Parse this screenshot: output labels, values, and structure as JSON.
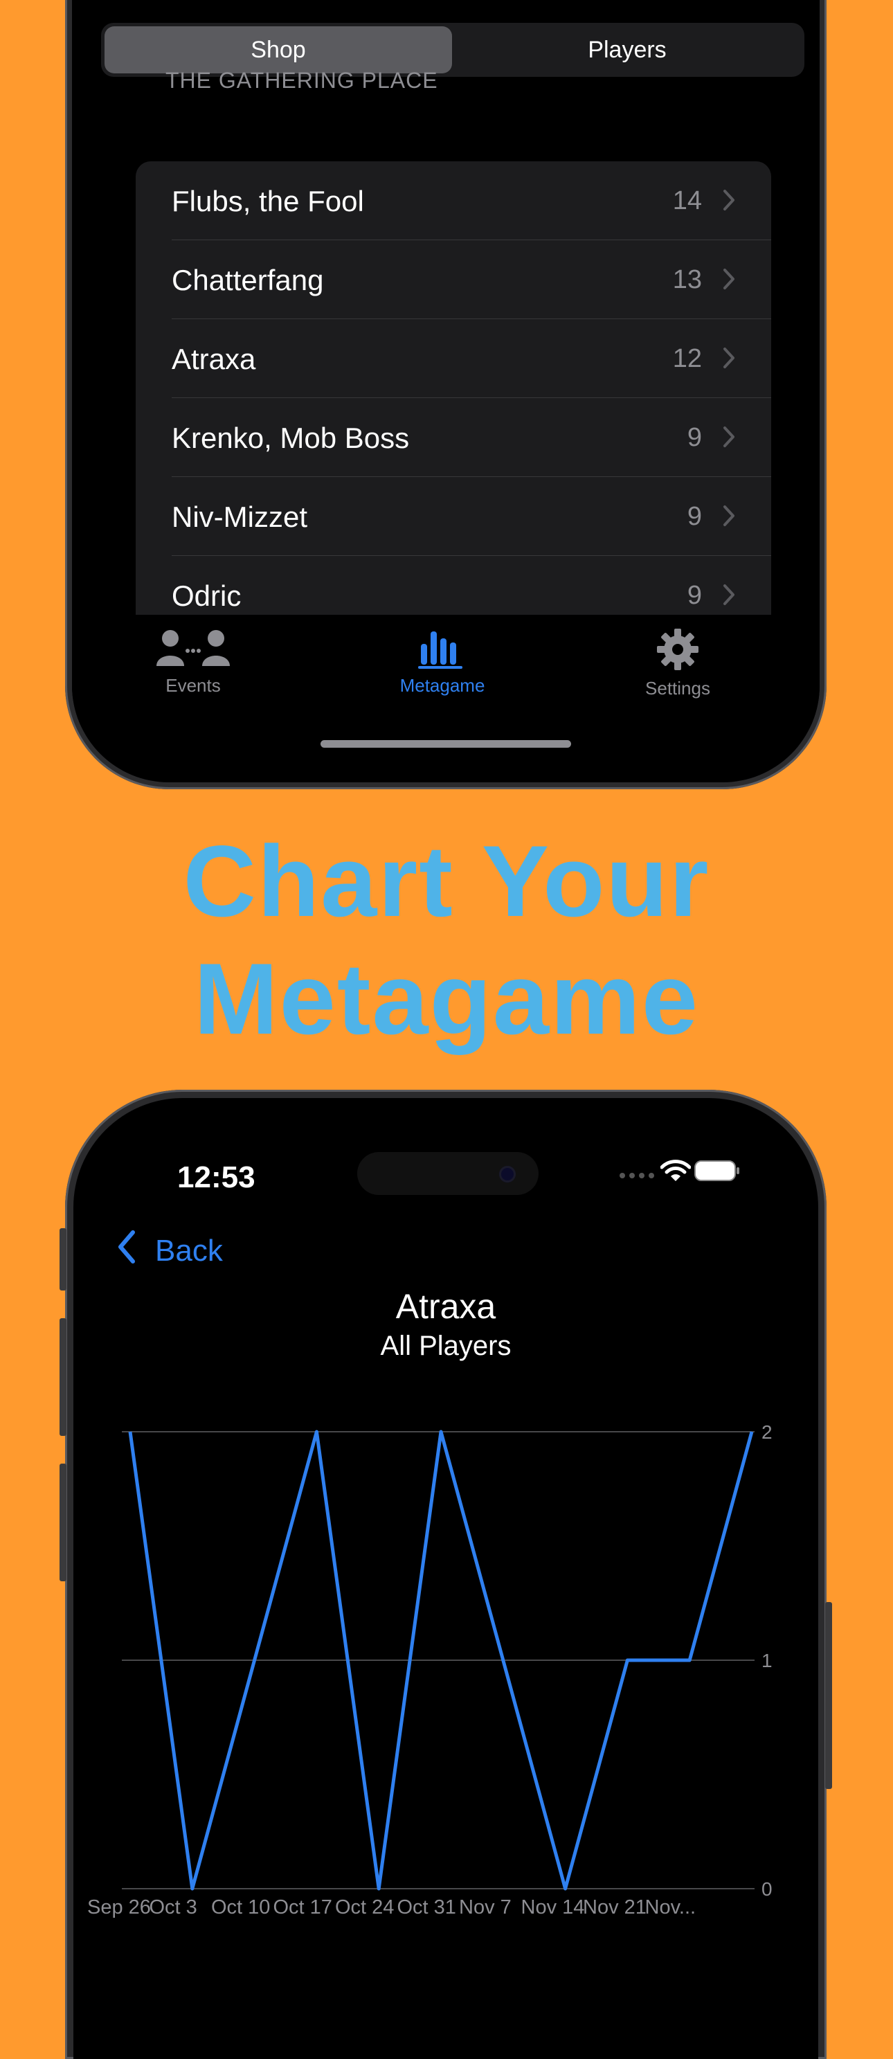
{
  "top_phone": {
    "segmented": {
      "shop_label": "Shop",
      "players_label": "Players"
    },
    "section_header": "THE GATHERING PLACE",
    "commanders": [
      {
        "name": "Flubs, the Fool",
        "count": "14"
      },
      {
        "name": "Chatterfang",
        "count": "13"
      },
      {
        "name": "Atraxa",
        "count": "12"
      },
      {
        "name": "Krenko, Mob Boss",
        "count": "9"
      },
      {
        "name": "Niv-Mizzet",
        "count": "9"
      },
      {
        "name": "Odric",
        "count": "9"
      }
    ],
    "tabbar": {
      "events_label": "Events",
      "metagame_label": "Metagame",
      "settings_label": "Settings",
      "active_tab": "Metagame"
    }
  },
  "headline": {
    "line1": "Chart Your",
    "line2": "Metagame"
  },
  "bottom_phone": {
    "status_bar": {
      "time": "12:53"
    },
    "nav": {
      "back_label": "Back"
    }
  },
  "chart_data": {
    "type": "line",
    "title": "Atraxa",
    "subtitle": "All Players",
    "x": [
      "Sep 26",
      "Oct 3",
      "Oct 10",
      "Oct 17",
      "Oct 24",
      "Oct 31",
      "Nov 7",
      "Nov 14",
      "Nov 21",
      "Nov..."
    ],
    "series": [
      {
        "values": [
          2,
          0,
          1,
          2,
          0,
          2,
          1,
          0,
          1,
          1,
          2
        ]
      }
    ],
    "y_ticks": [
      "0",
      "1",
      "2"
    ],
    "ylim": [
      0,
      2
    ],
    "y_axis_side": "right",
    "grid": true,
    "colors": {
      "line": "#2F80F0",
      "grid": "#48484a",
      "tick": "#8e8e93"
    }
  },
  "colors": {
    "background": "#FF9A2E",
    "headline": "#4FB3E8",
    "accent": "#2F80F0"
  }
}
